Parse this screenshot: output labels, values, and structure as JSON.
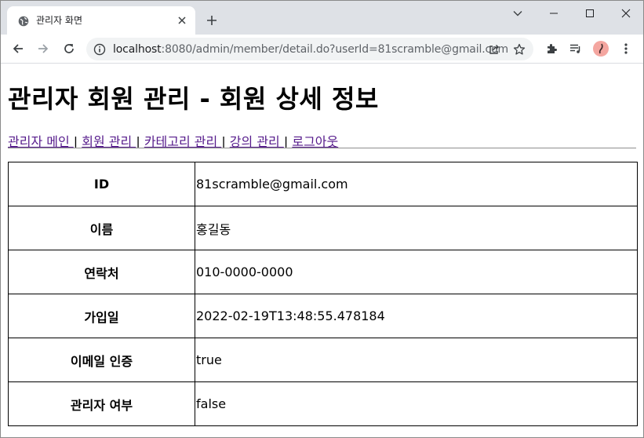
{
  "browser": {
    "tab_title": "관리자 화면",
    "url_host": "localhost",
    "url_rest": ":8080/admin/member/detail.do?userId=81scramble@gmail.com"
  },
  "page": {
    "title": "관리자 회원 관리 - 회원 상세 정보",
    "nav": [
      {
        "label": "관리자 메인 "
      },
      {
        "label": "회원 관리 "
      },
      {
        "label": "카테고리 관리 "
      },
      {
        "label": "강의 관리 "
      },
      {
        "label": "로그아웃"
      }
    ],
    "nav_separator": "|"
  },
  "member_detail": {
    "rows": [
      {
        "label": "ID",
        "value": "81scramble@gmail.com"
      },
      {
        "label": "이름",
        "value": "홍길동"
      },
      {
        "label": "연락처",
        "value": "010-0000-0000"
      },
      {
        "label": "가입일",
        "value": "2022-02-19T13:48:55.478184"
      },
      {
        "label": "이메일 인증",
        "value": "true"
      },
      {
        "label": "관리자 여부",
        "value": "false"
      }
    ]
  },
  "icons": {
    "favicon": "globe-icon",
    "tab_close": "close-icon",
    "new_tab": "plus-icon",
    "tab_search": "chevron-down-icon",
    "minimize": "minimize-icon",
    "maximize": "maximize-icon",
    "window_close": "close-icon",
    "back": "arrow-left-icon",
    "forward": "arrow-right-icon",
    "reload": "reload-icon",
    "site_info": "info-icon",
    "share": "share-icon",
    "bookmark": "star-icon",
    "extensions": "puzzle-icon",
    "media": "media-queue-icon",
    "profile": "avatar",
    "menu": "kebab-menu-icon"
  },
  "colors": {
    "tabstrip": "#dee1e6",
    "omnibox": "#f1f3f4",
    "visited_link": "#551a8b"
  }
}
